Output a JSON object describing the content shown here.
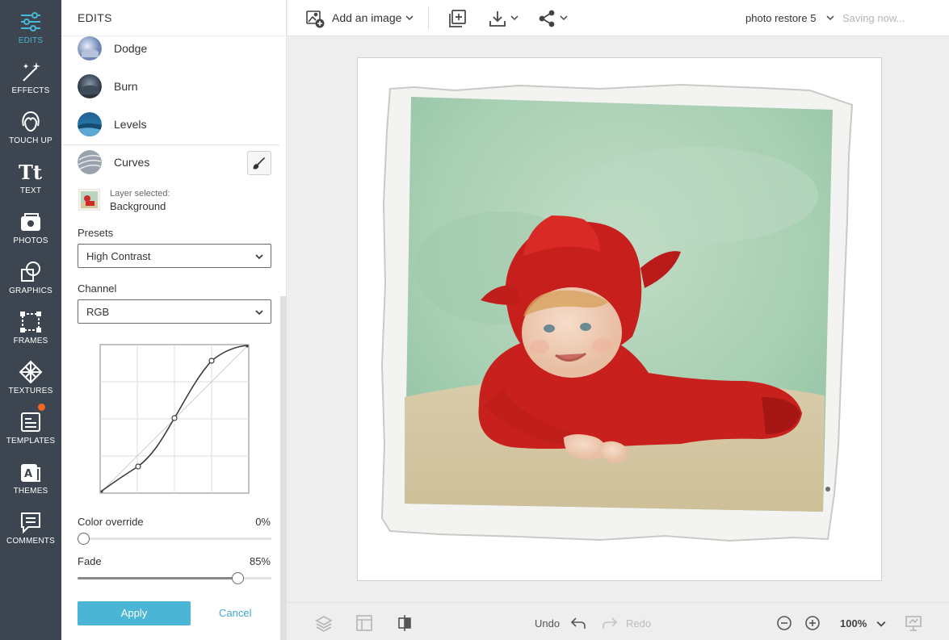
{
  "nav": {
    "items": [
      {
        "label": "EDITS",
        "icon": "sliders-icon",
        "active": true
      },
      {
        "label": "EFFECTS",
        "icon": "magic-wand-icon"
      },
      {
        "label": "TOUCH UP",
        "icon": "face-icon"
      },
      {
        "label": "TEXT",
        "icon": "text-icon"
      },
      {
        "label": "PHOTOS",
        "icon": "camera-icon"
      },
      {
        "label": "GRAPHICS",
        "icon": "shapes-icon"
      },
      {
        "label": "FRAMES",
        "icon": "frame-icon"
      },
      {
        "label": "TEXTURES",
        "icon": "texture-icon"
      },
      {
        "label": "TEMPLATES",
        "icon": "template-icon",
        "notification": true
      },
      {
        "label": "THEMES",
        "icon": "themes-icon"
      },
      {
        "label": "COMMENTS",
        "icon": "comment-icon"
      }
    ]
  },
  "panel": {
    "title": "EDITS",
    "tools": [
      {
        "label": "Dodge"
      },
      {
        "label": "Burn"
      },
      {
        "label": "Levels"
      },
      {
        "label": "Curves"
      }
    ],
    "layer": {
      "caption": "Layer selected:",
      "name": "Background"
    },
    "presets": {
      "label": "Presets",
      "value": "High Contrast"
    },
    "channel": {
      "label": "Channel",
      "value": "RGB"
    },
    "color_override": {
      "label": "Color override",
      "value": "0%",
      "level": 0
    },
    "fade": {
      "label": "Fade",
      "value": "85%",
      "level": 0.85
    },
    "apply_label": "Apply",
    "cancel_label": "Cancel"
  },
  "toolbar": {
    "add_image_label": "Add an image",
    "doc_title": "photo restore 5",
    "save_status": "Saving now..."
  },
  "bottombar": {
    "undo_label": "Undo",
    "redo_label": "Redo",
    "zoom": "100%"
  },
  "colors": {
    "nav_bg": "#3d4650",
    "accent": "#4bb5d6",
    "notification": "#f26522"
  }
}
